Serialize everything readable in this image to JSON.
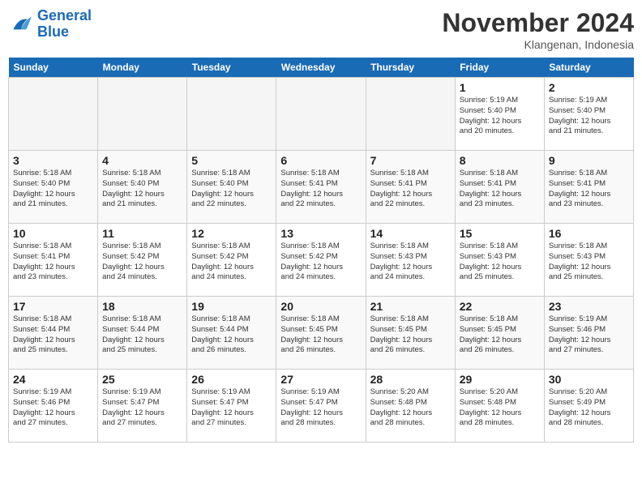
{
  "logo": {
    "line1": "General",
    "line2": "Blue"
  },
  "title": "November 2024",
  "location": "Klangenan, Indonesia",
  "weekdays": [
    "Sunday",
    "Monday",
    "Tuesday",
    "Wednesday",
    "Thursday",
    "Friday",
    "Saturday"
  ],
  "weeks": [
    [
      {
        "day": "",
        "info": ""
      },
      {
        "day": "",
        "info": ""
      },
      {
        "day": "",
        "info": ""
      },
      {
        "day": "",
        "info": ""
      },
      {
        "day": "",
        "info": ""
      },
      {
        "day": "1",
        "info": "Sunrise: 5:19 AM\nSunset: 5:40 PM\nDaylight: 12 hours\nand 20 minutes."
      },
      {
        "day": "2",
        "info": "Sunrise: 5:19 AM\nSunset: 5:40 PM\nDaylight: 12 hours\nand 21 minutes."
      }
    ],
    [
      {
        "day": "3",
        "info": "Sunrise: 5:18 AM\nSunset: 5:40 PM\nDaylight: 12 hours\nand 21 minutes."
      },
      {
        "day": "4",
        "info": "Sunrise: 5:18 AM\nSunset: 5:40 PM\nDaylight: 12 hours\nand 21 minutes."
      },
      {
        "day": "5",
        "info": "Sunrise: 5:18 AM\nSunset: 5:40 PM\nDaylight: 12 hours\nand 22 minutes."
      },
      {
        "day": "6",
        "info": "Sunrise: 5:18 AM\nSunset: 5:41 PM\nDaylight: 12 hours\nand 22 minutes."
      },
      {
        "day": "7",
        "info": "Sunrise: 5:18 AM\nSunset: 5:41 PM\nDaylight: 12 hours\nand 22 minutes."
      },
      {
        "day": "8",
        "info": "Sunrise: 5:18 AM\nSunset: 5:41 PM\nDaylight: 12 hours\nand 23 minutes."
      },
      {
        "day": "9",
        "info": "Sunrise: 5:18 AM\nSunset: 5:41 PM\nDaylight: 12 hours\nand 23 minutes."
      }
    ],
    [
      {
        "day": "10",
        "info": "Sunrise: 5:18 AM\nSunset: 5:41 PM\nDaylight: 12 hours\nand 23 minutes."
      },
      {
        "day": "11",
        "info": "Sunrise: 5:18 AM\nSunset: 5:42 PM\nDaylight: 12 hours\nand 24 minutes."
      },
      {
        "day": "12",
        "info": "Sunrise: 5:18 AM\nSunset: 5:42 PM\nDaylight: 12 hours\nand 24 minutes."
      },
      {
        "day": "13",
        "info": "Sunrise: 5:18 AM\nSunset: 5:42 PM\nDaylight: 12 hours\nand 24 minutes."
      },
      {
        "day": "14",
        "info": "Sunrise: 5:18 AM\nSunset: 5:43 PM\nDaylight: 12 hours\nand 24 minutes."
      },
      {
        "day": "15",
        "info": "Sunrise: 5:18 AM\nSunset: 5:43 PM\nDaylight: 12 hours\nand 25 minutes."
      },
      {
        "day": "16",
        "info": "Sunrise: 5:18 AM\nSunset: 5:43 PM\nDaylight: 12 hours\nand 25 minutes."
      }
    ],
    [
      {
        "day": "17",
        "info": "Sunrise: 5:18 AM\nSunset: 5:44 PM\nDaylight: 12 hours\nand 25 minutes."
      },
      {
        "day": "18",
        "info": "Sunrise: 5:18 AM\nSunset: 5:44 PM\nDaylight: 12 hours\nand 25 minutes."
      },
      {
        "day": "19",
        "info": "Sunrise: 5:18 AM\nSunset: 5:44 PM\nDaylight: 12 hours\nand 26 minutes."
      },
      {
        "day": "20",
        "info": "Sunrise: 5:18 AM\nSunset: 5:45 PM\nDaylight: 12 hours\nand 26 minutes."
      },
      {
        "day": "21",
        "info": "Sunrise: 5:18 AM\nSunset: 5:45 PM\nDaylight: 12 hours\nand 26 minutes."
      },
      {
        "day": "22",
        "info": "Sunrise: 5:18 AM\nSunset: 5:45 PM\nDaylight: 12 hours\nand 26 minutes."
      },
      {
        "day": "23",
        "info": "Sunrise: 5:19 AM\nSunset: 5:46 PM\nDaylight: 12 hours\nand 27 minutes."
      }
    ],
    [
      {
        "day": "24",
        "info": "Sunrise: 5:19 AM\nSunset: 5:46 PM\nDaylight: 12 hours\nand 27 minutes."
      },
      {
        "day": "25",
        "info": "Sunrise: 5:19 AM\nSunset: 5:47 PM\nDaylight: 12 hours\nand 27 minutes."
      },
      {
        "day": "26",
        "info": "Sunrise: 5:19 AM\nSunset: 5:47 PM\nDaylight: 12 hours\nand 27 minutes."
      },
      {
        "day": "27",
        "info": "Sunrise: 5:19 AM\nSunset: 5:47 PM\nDaylight: 12 hours\nand 28 minutes."
      },
      {
        "day": "28",
        "info": "Sunrise: 5:20 AM\nSunset: 5:48 PM\nDaylight: 12 hours\nand 28 minutes."
      },
      {
        "day": "29",
        "info": "Sunrise: 5:20 AM\nSunset: 5:48 PM\nDaylight: 12 hours\nand 28 minutes."
      },
      {
        "day": "30",
        "info": "Sunrise: 5:20 AM\nSunset: 5:49 PM\nDaylight: 12 hours\nand 28 minutes."
      }
    ]
  ]
}
